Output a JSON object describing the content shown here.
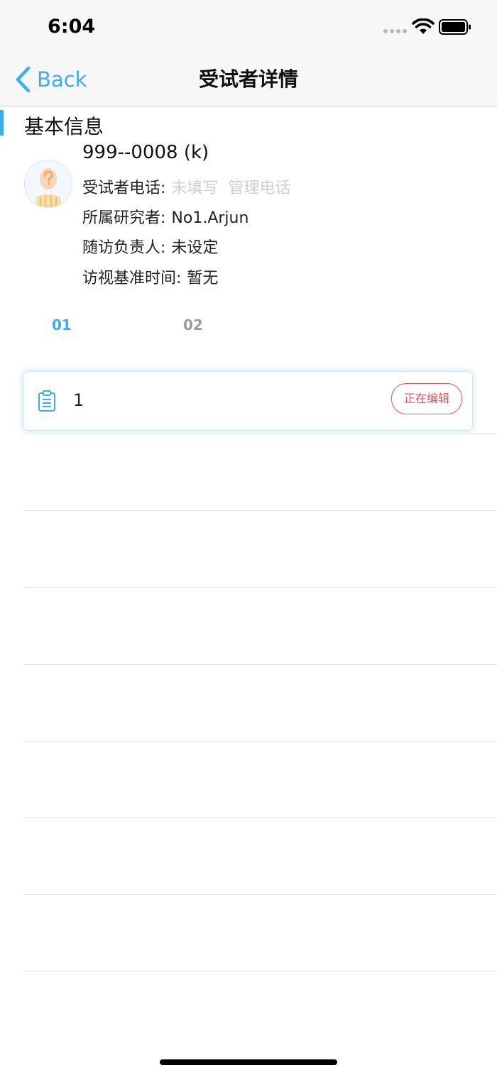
{
  "status_bar": {
    "time": "6:04",
    "wifi_icon": "wifi-icon",
    "battery_icon": "battery-icon"
  },
  "nav": {
    "back_label": "Back",
    "title": "受试者详情"
  },
  "section": {
    "title": "基本信息"
  },
  "subject": {
    "id": "999--0008 (k)",
    "avatar_icon": "person-placeholder-icon",
    "phone_label": "受试者电话:",
    "phone_value": "未填写",
    "phone_manage": "管理电话",
    "researcher_label": "所属研究者:",
    "researcher_value": "No1.Arjun",
    "followup_label": "随访负责人:",
    "followup_value": "未设定",
    "visit_base_label": "访视基准时间:",
    "visit_base_value": "暂无"
  },
  "tabs": [
    {
      "label": "01",
      "active": true
    },
    {
      "label": "02",
      "active": false
    }
  ],
  "forms": [
    {
      "icon": "clipboard-icon",
      "name": "1",
      "status": "正在编辑"
    }
  ],
  "colors": {
    "accent": "#3aaef0",
    "status_editing": "#f0505a",
    "muted": "#cfcfcf"
  }
}
